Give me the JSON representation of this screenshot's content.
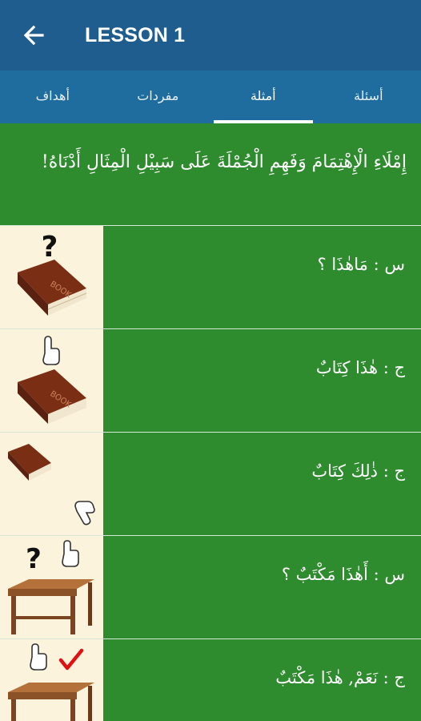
{
  "header": {
    "title": "LESSON 1",
    "back_icon": "arrow-left-icon"
  },
  "tabs": [
    {
      "label": "أسئلة",
      "active": false
    },
    {
      "label": "أمثلة",
      "active": true
    },
    {
      "label": "مفردات",
      "active": false
    },
    {
      "label": "أهداف",
      "active": false
    }
  ],
  "intro": {
    "text": "إِمْلَاءِ الْإِهْتِمَامَ وَفَهِمِ الْجُمْلَةَ عَلَى سَبِيْلِ الْمِثَالِ أَدْنَاهُ!"
  },
  "rows": [
    {
      "text": "س : مَاهٰذَا ؟",
      "icons": [
        "question-mark-icon",
        "book-icon"
      ]
    },
    {
      "text": "ج : هٰذَا كِتَابٌ",
      "icons": [
        "pointing-hand-icon",
        "book-icon"
      ]
    },
    {
      "text": "ج : ذٰلِكَ كِتَابٌ",
      "icons": [
        "book-icon",
        "pointing-hand-icon"
      ]
    },
    {
      "text": "س : أَهٰذَا مَكْتَبٌ ؟",
      "icons": [
        "question-mark-icon",
        "pointing-hand-icon",
        "desk-icon"
      ]
    },
    {
      "text": "ج : نَعَمْ, هٰذَا مَكْتَبٌ",
      "icons": [
        "pointing-hand-icon",
        "checkmark-icon",
        "desk-icon"
      ]
    }
  ],
  "colors": {
    "appbar": "#1e5d8e",
    "tabbar": "#1e6d9e",
    "content": "#2e8b2e",
    "image_bg": "#fcf3dc"
  }
}
